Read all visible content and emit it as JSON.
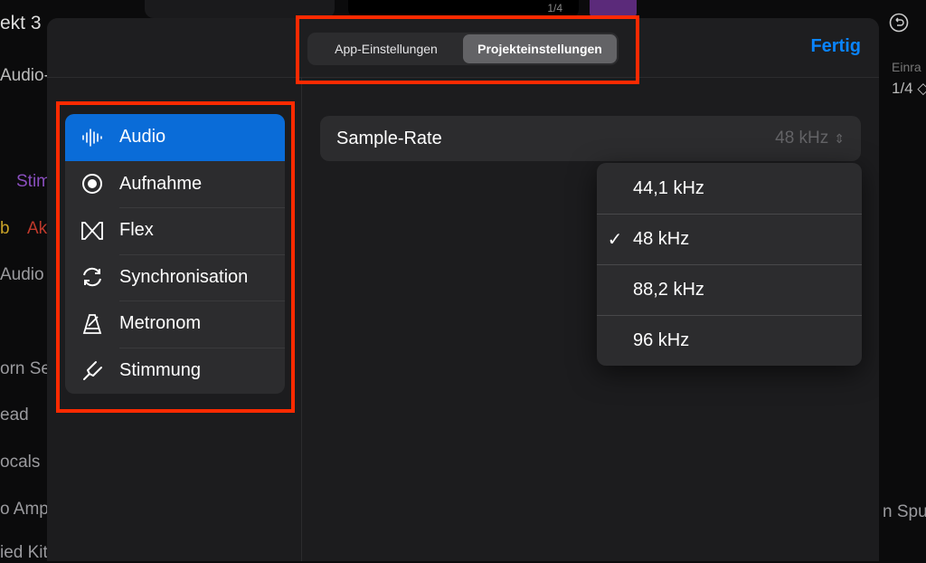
{
  "background": {
    "project_title": "ekt 3",
    "track_labels": [
      "Audio-",
      "Stim",
      "b",
      "Ak",
      "Audio",
      "orn Se",
      "ead",
      "ocals",
      "o Amp",
      "ied Kit"
    ],
    "right_labels": {
      "einrasten": "Einra",
      "value": "1/4 ◇",
      "new_track": "n Spur"
    },
    "counter": "1/4"
  },
  "header": {
    "tabs": [
      {
        "label": "App-Einstellungen",
        "selected": false
      },
      {
        "label": "Projekteinstellungen",
        "selected": true
      }
    ],
    "done_label": "Fertig"
  },
  "sidebar": {
    "items": [
      {
        "label": "Audio",
        "icon": "waveform-icon",
        "selected": true
      },
      {
        "label": "Aufnahme",
        "icon": "record-icon"
      },
      {
        "label": "Flex",
        "icon": "flex-icon"
      },
      {
        "label": "Synchronisation",
        "icon": "sync-icon"
      },
      {
        "label": "Metronom",
        "icon": "metronome-icon"
      },
      {
        "label": "Stimmung",
        "icon": "tuning-fork-icon"
      }
    ]
  },
  "main": {
    "sample_rate": {
      "label": "Sample-Rate",
      "value": "48 kHz",
      "options": [
        {
          "label": "44,1 kHz"
        },
        {
          "label": "48 kHz",
          "checked": true,
          "check": "✓"
        },
        {
          "label": "88,2 kHz"
        },
        {
          "label": "96 kHz"
        }
      ]
    }
  },
  "colors": {
    "accent": "#0a84ff",
    "selection": "#0a6cd8",
    "annotation": "#ff2a00"
  }
}
